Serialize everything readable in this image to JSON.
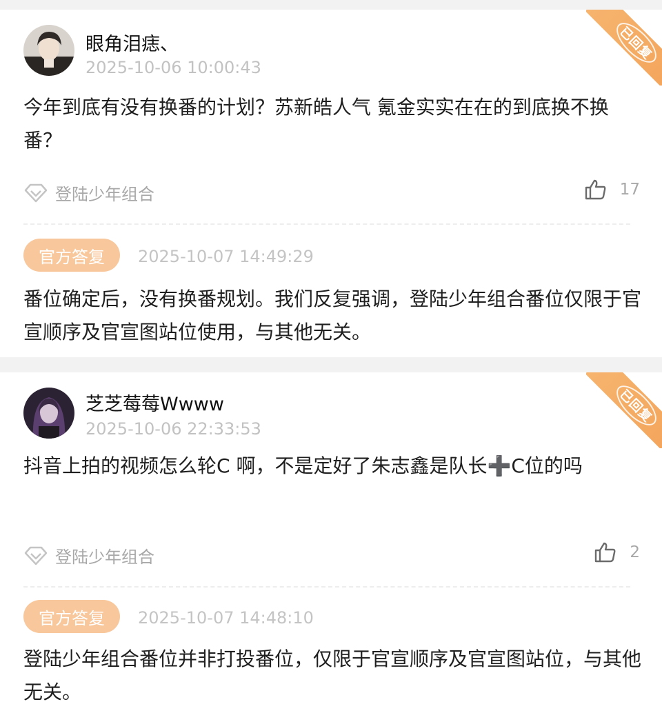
{
  "posts": [
    {
      "username": "眼角泪痣、",
      "timestamp": "2025-10-06 10:00:43",
      "question": "今年到底有没有换番的计划？苏新皓人气 氪金实实在在的到底换不换番？",
      "tag": "登陆少年组合",
      "likes": "17",
      "corner_badge": "已回复",
      "official_label": "官方答复",
      "reply_time": "2025-10-07 14:49:29",
      "answer": "番位确定后，没有换番规划。我们反复强调，登陆少年组合番位仅限于官宣顺序及官宣图站位使用，与其他无关。"
    },
    {
      "username": "芝芝莓莓Wwww",
      "timestamp": "2025-10-06 22:33:53",
      "question": "抖音上拍的视频怎么轮C  啊，不是定好了朱志鑫是队长➕C位的吗",
      "tag": "登陆少年组合",
      "likes": "2",
      "corner_badge": "已回复",
      "official_label": "官方答复",
      "reply_time": "2025-10-07 14:48:10",
      "answer": "登陆少年组合番位并非打投番位，仅限于官宣顺序及官宣图站位，与其他无关。"
    }
  ],
  "colors": {
    "accent_orange": "#f3a45b",
    "badge_bg": "#f8c79b",
    "muted_text": "#a8a8a8"
  },
  "icons": [
    "diamond-tag-icon",
    "thumbs-up-icon",
    "replied-seal-icon"
  ]
}
